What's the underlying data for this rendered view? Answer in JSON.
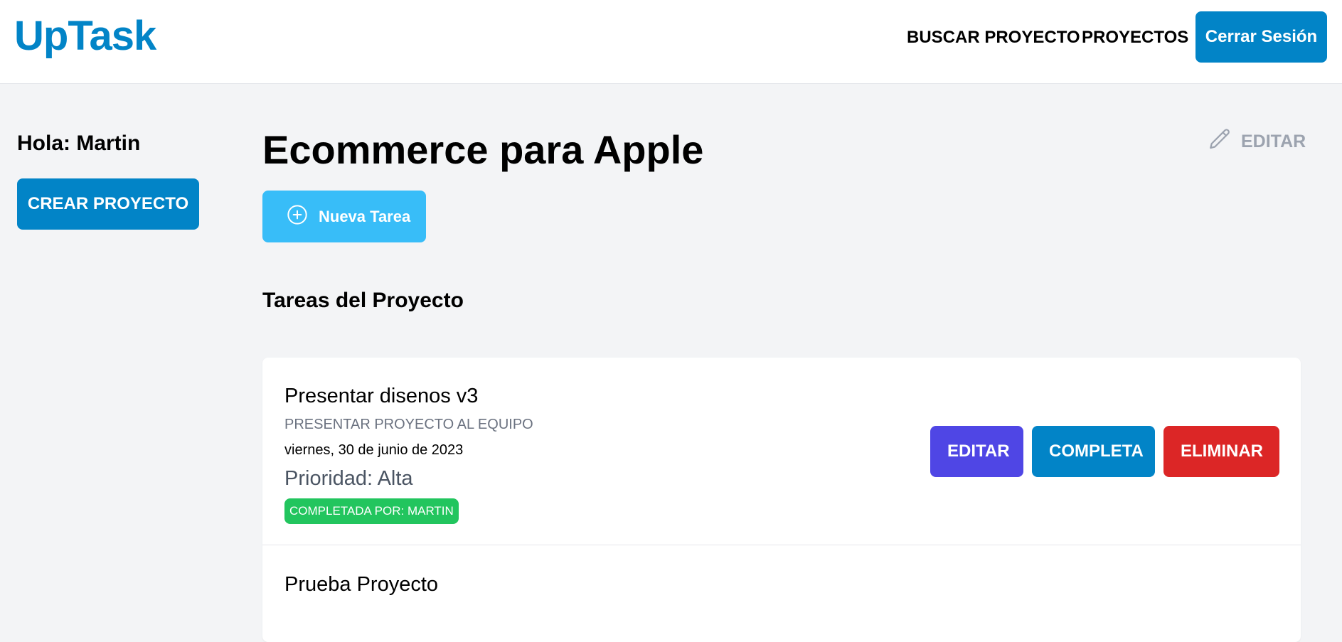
{
  "header": {
    "logo": "UpTask",
    "nav": {
      "search_label": "BUSCAR PROYECTO",
      "projects_label": "PROYECTOS"
    },
    "logout_label": "Cerrar Sesión"
  },
  "sidebar": {
    "greeting": "Hola: Martin",
    "create_project_label": "CREAR PROYECTO"
  },
  "main": {
    "project_title": "Ecommerce para Apple",
    "edit_label": "EDITAR",
    "new_task_label": "Nueva Tarea",
    "tasks_title": "Tareas del Proyecto",
    "tasks": [
      {
        "name": "Presentar disenos v3",
        "description": "PRESENTAR PROYECTO AL EQUIPO",
        "date": "viernes, 30 de junio de 2023",
        "priority": "Prioridad: Alta",
        "badge": "COMPLETADA POR: MARTIN",
        "actions": {
          "edit": "EDITAR",
          "complete": "COMPLETA",
          "delete": "ELIMINAR"
        }
      },
      {
        "name": "Prueba Proyecto"
      }
    ]
  },
  "colors": {
    "brand": "#0284c7",
    "new_task": "#38bdf8",
    "edit": "#4f46e5",
    "delete": "#dc2626",
    "badge": "#22c55e"
  }
}
